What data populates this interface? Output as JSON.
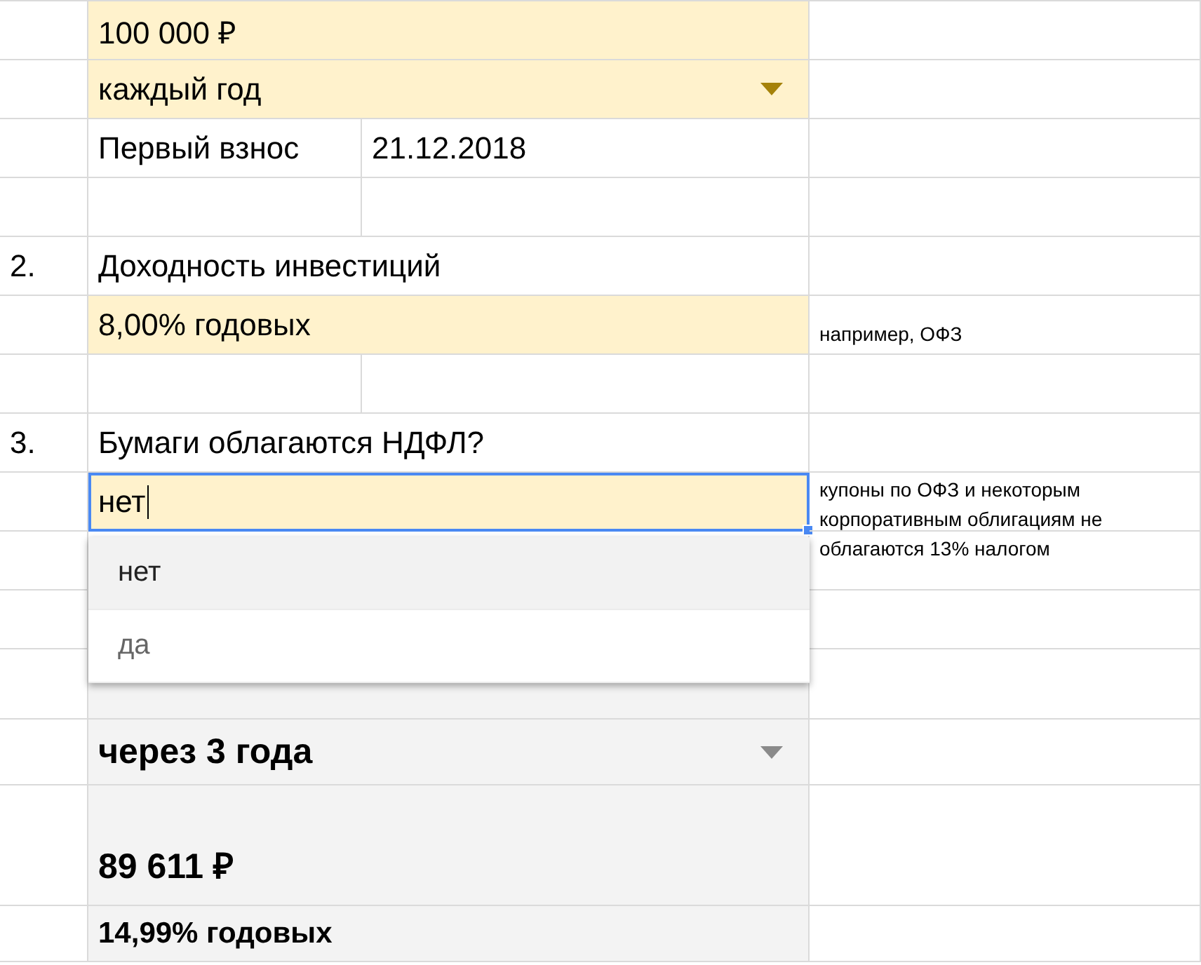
{
  "amount": {
    "value": "100 000 ₽"
  },
  "frequency": {
    "value": "каждый год"
  },
  "first_payment": {
    "label": "Первый взнос",
    "value": "21.12.2018"
  },
  "section_2": {
    "number": "2.",
    "title": "Доходность инвестиций",
    "value": "8,00% годовых",
    "note": "например, ОФЗ"
  },
  "section_3": {
    "number": "3.",
    "title": "Бумаги облагаются НДФЛ?",
    "editing_value": "нет",
    "note": "купоны по ОФЗ и некоторым корпоративным облигациям не облагаются 13% налогом"
  },
  "dropdown": {
    "options": [
      {
        "label": "нет",
        "selected": true
      },
      {
        "label": "да",
        "selected": false
      }
    ]
  },
  "result": {
    "period": "через 3 года",
    "amount": "89 611 ₽",
    "rate": "14,99% годовых"
  }
}
